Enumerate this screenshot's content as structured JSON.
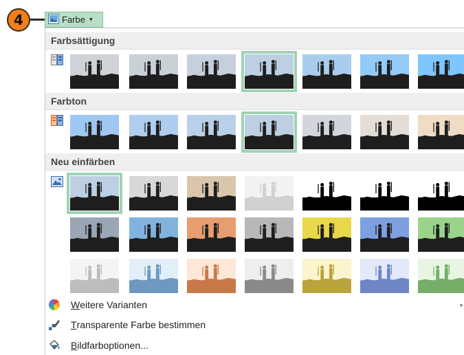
{
  "badge": {
    "step": "4"
  },
  "ribbon": {
    "button_label": "Farbe",
    "caret": "▾"
  },
  "sections": {
    "saturation": {
      "title": "Farbsättigung"
    },
    "hue": {
      "title": "Farbton"
    },
    "recolor": {
      "title": "Neu einfärben"
    }
  },
  "menu": {
    "more_variants": {
      "accel": "W",
      "rest": "eitere Varianten",
      "arrow": "▸"
    },
    "transparent": {
      "accel": "T",
      "rest": "ransparente Farbe bestimmen"
    },
    "picture_options": {
      "accel": "B",
      "rest": "ildfarboptionen..."
    }
  },
  "colors": {
    "selection_outline": "#9fd3b3",
    "ribbon_button_bg": "#b9dfc7",
    "badge_orange": "#f07f1a",
    "header_bg": "#efefef"
  },
  "swatches": {
    "saturation": [
      {
        "sky": "#cfd3d8",
        "ground": "#6b6b6b"
      },
      {
        "sky": "#c9d0d8",
        "ground": "#6f6a66"
      },
      {
        "sky": "#c6d0dc",
        "ground": "#746b62"
      },
      {
        "sky": "#bcd0e2",
        "ground": "#7d6a5a",
        "selected": true
      },
      {
        "sky": "#a9cdee",
        "ground": "#856a4f"
      },
      {
        "sky": "#94caf6",
        "ground": "#8f6944"
      },
      {
        "sky": "#7ec6ff",
        "ground": "#96693a"
      }
    ],
    "hue": [
      {
        "sky": "#9ec7f2",
        "ground": "#7a6a58"
      },
      {
        "sky": "#aecdef",
        "ground": "#7c6a5a"
      },
      {
        "sky": "#b9d1e8",
        "ground": "#7d6a5a"
      },
      {
        "sky": "#bcd0e2",
        "ground": "#7d6a5a",
        "selected": true
      },
      {
        "sky": "#d2d6dc",
        "ground": "#7e6c5c"
      },
      {
        "sky": "#e4ddd5",
        "ground": "#806d5a"
      },
      {
        "sky": "#f0dcc5",
        "ground": "#846b52"
      }
    ],
    "recolor": [
      [
        {
          "sky": "#bcd0e2",
          "ground": "#7d6a5a",
          "selected": true
        },
        {
          "sky": "#d8d8d8",
          "ground": "#707070"
        },
        {
          "sky": "#d9c6ad",
          "ground": "#6e5b45"
        },
        {
          "sky": "#f2f2f2",
          "ground": "#e6e6e6",
          "fig": "#d0d0d0"
        },
        {
          "sky": "#ffffff",
          "ground": "#1a1a1a",
          "fig": "#000000"
        },
        {
          "sky": "#ffffff",
          "ground": "#000000",
          "fig": "#000000"
        },
        {
          "sky": "#ffffff",
          "ground": "#000000",
          "fig": "#000000"
        }
      ],
      [
        {
          "sky": "#9aa6b4",
          "ground": "#2f3642"
        },
        {
          "sky": "#82b3de",
          "ground": "#2a4a6a"
        },
        {
          "sky": "#e79d6f",
          "ground": "#6a3518"
        },
        {
          "sky": "#b8b8b8",
          "ground": "#3c3c3c"
        },
        {
          "sky": "#e8d84a",
          "ground": "#6a5e10"
        },
        {
          "sky": "#7ea0e0",
          "ground": "#203a78"
        },
        {
          "sky": "#9ad48a",
          "ground": "#2f5c24"
        }
      ],
      [
        {
          "sky": "#f4f4f4",
          "ground": "#d0d0d0",
          "fig": "#bdbdbd"
        },
        {
          "sky": "#e2eef8",
          "ground": "#9cbcd8",
          "fig": "#6e98c0"
        },
        {
          "sky": "#fde7d6",
          "ground": "#e6a57e",
          "fig": "#c9784a"
        },
        {
          "sky": "#eeeeee",
          "ground": "#aaaaaa",
          "fig": "#8a8a8a"
        },
        {
          "sky": "#fbf4cf",
          "ground": "#dcc86a",
          "fig": "#b9a33c"
        },
        {
          "sky": "#e3e9f8",
          "ground": "#98acdc",
          "fig": "#6e86c6"
        },
        {
          "sky": "#e8f5e2",
          "ground": "#a6d298",
          "fig": "#76ad68"
        }
      ]
    ]
  }
}
